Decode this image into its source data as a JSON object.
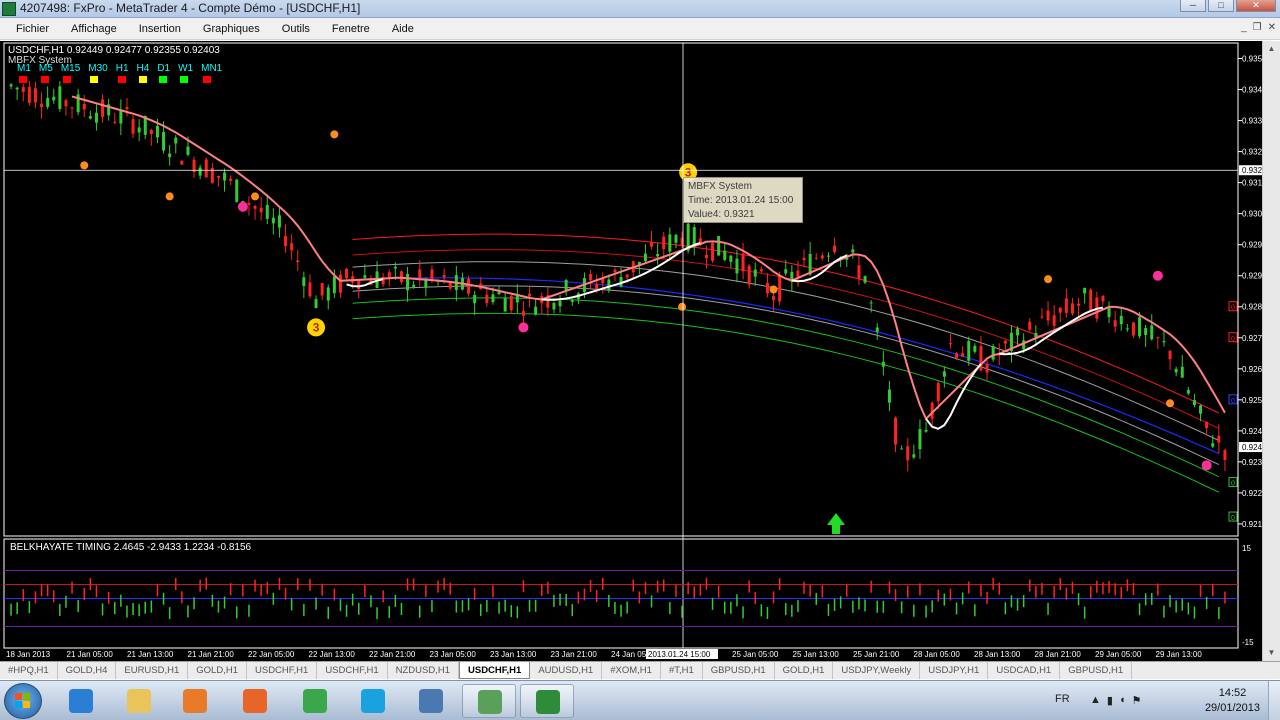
{
  "window": {
    "title": "4207498: FxPro - MetaTrader 4 - Compte Démo - [USDCHF,H1]"
  },
  "menu": {
    "items": [
      "Fichier",
      "Affichage",
      "Insertion",
      "Graphiques",
      "Outils",
      "Fenetre",
      "Aide"
    ]
  },
  "chart": {
    "header": "USDCHF,H1  0.92449 0.92477 0.92355 0.92403",
    "indicator_label": "MBFX System",
    "timeframes": [
      "M1",
      "M5",
      "M15",
      "M30",
      "H1",
      "H4",
      "D1",
      "W1",
      "MN1"
    ],
    "timeframe_colors": [
      "#ff0000",
      "#ff0000",
      "#ff0000",
      "#ffff00",
      "#ff0000",
      "#ffff00",
      "#00ff00",
      "#00ff00",
      "#ff0000"
    ],
    "current_price": "0.92403",
    "crosshair_price": "0.93206",
    "crosshair_time": "2013.01.24 15:00",
    "price_axis": [
      "0.93530",
      "0.93440",
      "0.93350",
      "0.93260",
      "0.93170",
      "0.93080",
      "0.92990",
      "0.92900",
      "0.92810",
      "0.92720",
      "0.92630",
      "0.92540",
      "0.92450",
      "0.92360",
      "0.92270",
      "0.92180"
    ],
    "time_axis": [
      "18 Jan 2013",
      "21 Jan 05:00",
      "21 Jan 13:00",
      "21 Jan 21:00",
      "22 Jan 05:00",
      "22 Jan 13:00",
      "22 Jan 21:00",
      "23 Jan 05:00",
      "23 Jan 13:00",
      "23 Jan 21:00",
      "24 Jan 05:00",
      "24 Jan 21:00",
      "25 Jan 05:00",
      "25 Jan 13:00",
      "25 Jan 21:00",
      "28 Jan 05:00",
      "28 Jan 13:00",
      "28 Jan 21:00",
      "29 Jan 05:00",
      "29 Jan 13:00"
    ],
    "signal_labels": [
      "3",
      "3"
    ],
    "band_badges": [
      "0",
      "0",
      "0",
      "0",
      "0"
    ],
    "tooltip": {
      "name": "MBFX System",
      "time": "Time: 2013.01.24 15:00",
      "value": "Value4: 0.9321"
    },
    "subwindow": {
      "header": "BELKHAYATE TIMING  2.4645 -2.9433 1.2234 -0.8156",
      "scale_top": "15",
      "scale_bottom": "-15"
    }
  },
  "tabs": [
    "#HPQ,H1",
    "GOLD,H4",
    "EURUSD,H1",
    "GOLD,H1",
    "USDCHF,H1",
    "USDCHF,H1",
    "NZDUSD,H1",
    "USDCHF,H1",
    "AUDUSD,H1",
    "#XOM,H1",
    "#T,H1",
    "GBPUSD,H1",
    "GOLD,H1",
    "USDJPY,Weekly",
    "USDJPY,H1",
    "USDCAD,H1",
    "GBPUSD,H1"
  ],
  "active_tab": 7,
  "taskbar": {
    "language": "FR",
    "time": "14:52",
    "date": "29/01/2013",
    "apps": [
      "internet-explorer",
      "file-explorer",
      "media-player",
      "firefox",
      "chrome",
      "skype",
      "windows-app",
      "photo-app",
      "metatrader"
    ]
  }
}
